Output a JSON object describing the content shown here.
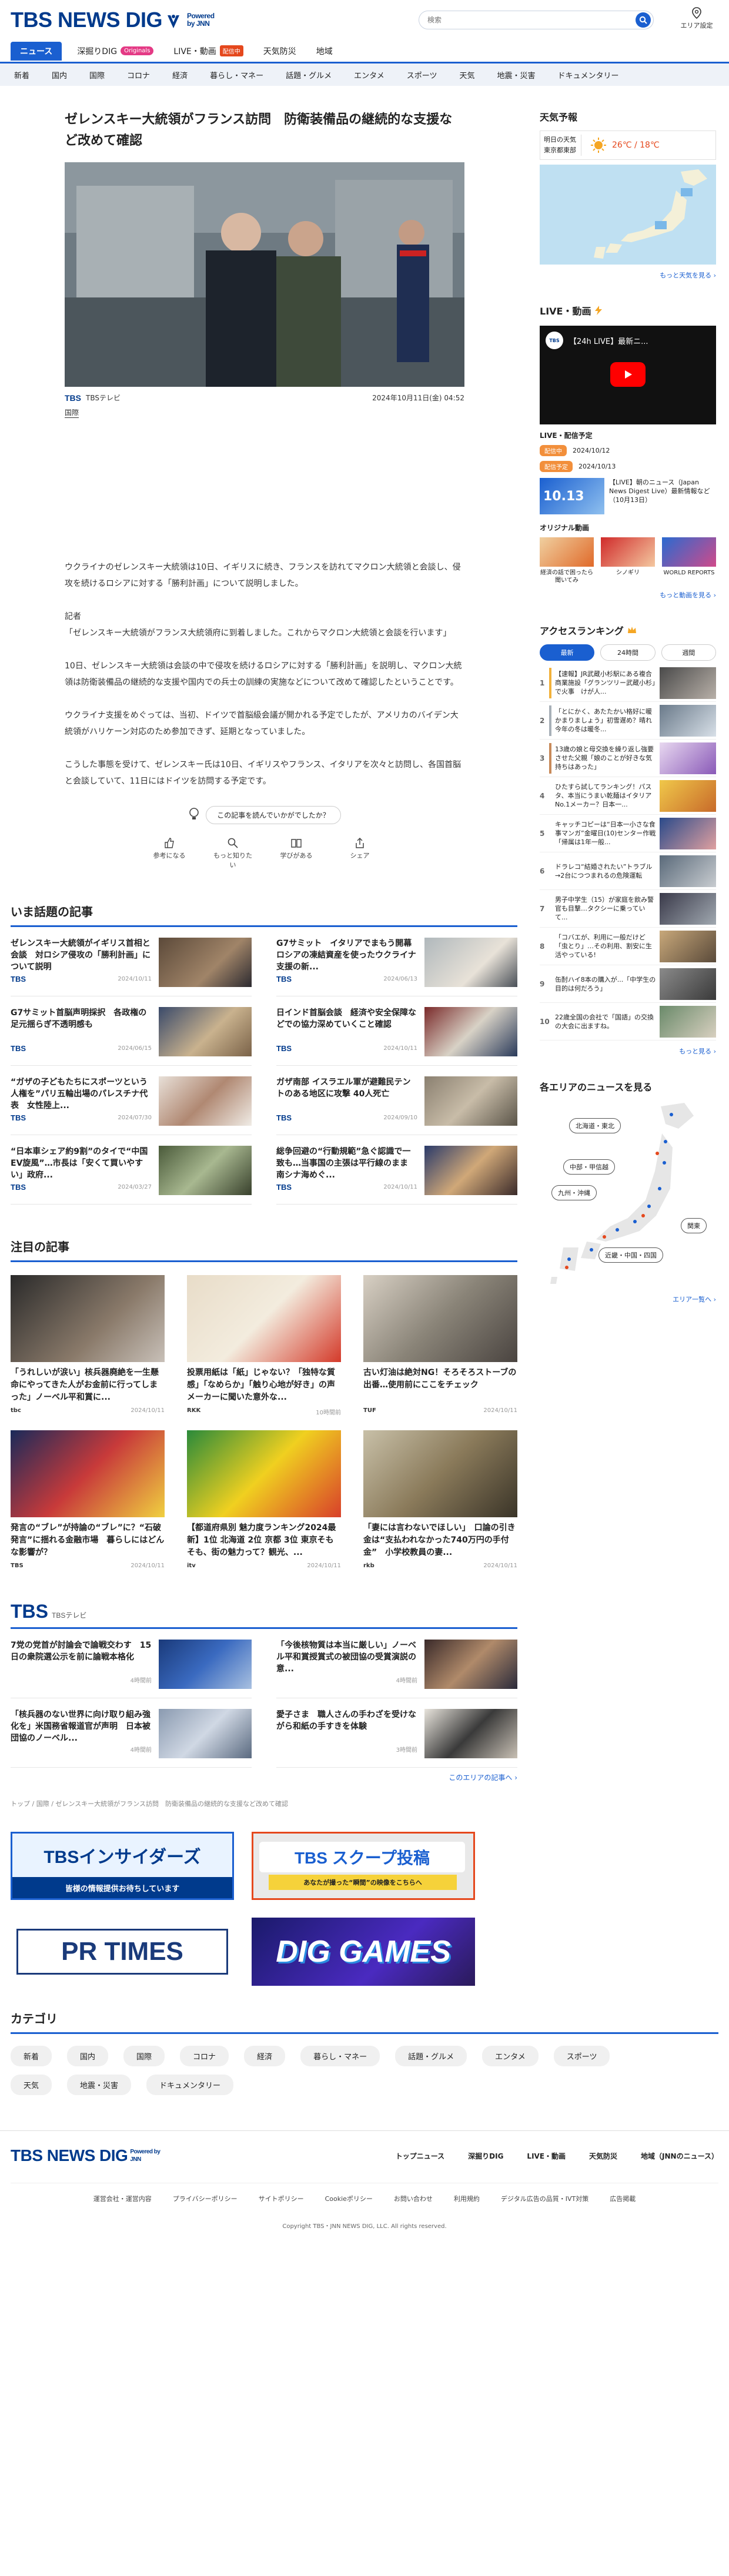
{
  "header": {
    "logo_text": "TBS NEWS DIG",
    "powered": "Powered by JNN",
    "search_placeholder": "検索",
    "area_setting": "エリア設定"
  },
  "nav": {
    "items": [
      "ニュース",
      "深掘りDIG",
      "LIVE・動画",
      "天気防災",
      "地域"
    ],
    "originals_badge": "Originals",
    "live_badge": "配信中"
  },
  "subnav": [
    "新着",
    "国内",
    "国際",
    "コロナ",
    "経済",
    "暮らし・マネー",
    "話題・グルメ",
    "エンタメ",
    "スポーツ",
    "天気",
    "地震・災害",
    "ドキュメンタリー"
  ],
  "article": {
    "title": "ゼレンスキー大統領がフランス訪問　防衛装備品の継続的な支援など改めて確認",
    "source": "TBSテレビ",
    "date": "2024年10月11日(金) 04:52",
    "tag": "国際",
    "paragraphs": [
      "ウクライナのゼレンスキー大統領は10日、イギリスに続き、フランスを訪れてマクロン大統領と会談し、侵攻を続けるロシアに対する「勝利計画」について説明しました。",
      "記者\n「ゼレンスキー大統領がフランス大統領府に到着しました。これからマクロン大統領と会談を行います」",
      "10日、ゼレンスキー大統領は会談の中で侵攻を続けるロシアに対する「勝利計画」を説明し、マクロン大統領は防衛装備品の継続的な支援や国内での兵士の訓練の実施などについて改めて確認したということです。",
      "ウクライナ支援をめぐっては、当初、ドイツで首脳級会議が開かれる予定でしたが、アメリカのバイデン大統領がハリケーン対応のため参加できず、延期となっていました。",
      "こうした事態を受けて、ゼレンスキー氏は10日、イギリスやフランス、イタリアを次々と訪問し、各国首脳と会談していて、11日にはドイツを訪問する予定です。"
    ],
    "feedback_question": "この記事を読んでいかがでしたか？",
    "feedback": [
      "参考になる",
      "もっと知りたい",
      "学びがある",
      "シェア"
    ]
  },
  "trending": {
    "title": "いま話題の記事",
    "items": [
      {
        "title": "ゼレンスキー大統領がイギリス首相と会談　対ロシア侵攻の「勝利計画」について説明",
        "src": "TBS",
        "date": "2024/10/11"
      },
      {
        "title": "G7サミット　イタリアでまもう開幕　ロシアの凍結資産を使ったウクライナ支援の新...",
        "src": "TBS",
        "date": "2024/06/13"
      },
      {
        "title": "G7サミット首脳声明採択　各政権の足元揺らぎ不透明感も",
        "src": "TBS",
        "date": "2024/06/15"
      },
      {
        "title": "日インド首脳会談　経済や安全保障などでの協力深めていくこと確認",
        "src": "TBS",
        "date": "2024/10/11"
      },
      {
        "title": "“ガザの子どもたちにスポーツという人権を”パリ五輪出場のパレスチナ代表　女性陸上...",
        "src": "TBS",
        "date": "2024/07/30"
      },
      {
        "title": "ガザ南部 イスラエル軍が避難民テントのある地区に攻撃 40人死亡",
        "src": "TBS",
        "date": "2024/09/10"
      },
      {
        "title": "“日本車シェア約9割”のタイで“中国EV旋風”…市長は「安くて買いやすい」政府...",
        "src": "TBS",
        "date": "2024/03/27"
      },
      {
        "title": "総争回避の“行動規範”急ぐ認識で一致も…当事国の主張は平行線のまま 南シナ海めぐ...",
        "src": "TBS",
        "date": "2024/10/11"
      }
    ]
  },
  "featured": {
    "title": "注目の記事",
    "items": [
      {
        "title": "「うれしいが涙い」核兵器廃絶を一生懸命にやってきた人がお金前に行ってしまった」ノーベル平和賞に...",
        "src": "tbc",
        "date": "2024/10/11"
      },
      {
        "title": "投票用紙は「紙」じゃない？「独特な質感」「なめらか」「触り心地が好き」の声 メーカーに聞いた意外な...",
        "src": "RKK",
        "date": "10時間前"
      },
      {
        "title": "古い灯油は絶対NG！そろそろストーブの出番…使用前にここをチェック",
        "src": "TUF",
        "date": "2024/10/11"
      },
      {
        "title": "発言の“ブレ”が持論の“ブレ”に？“石破発言”に揺れる金融市場　暮らしにはどんな影響が？",
        "src": "TBS",
        "date": "2024/10/11"
      },
      {
        "title": "【都道府県別 魅力度ランキング2024最新】1位 北海道 2位 京都 3位 東京そもそも、街の魅力って？観光、...",
        "src": "itv",
        "date": "2024/10/11"
      },
      {
        "title": "「妻には言わないでほしい」　口論の引き金は“支払われなかった740万円の手付金”　小学校教員の妻...",
        "src": "rkb",
        "date": "2024/10/11"
      }
    ]
  },
  "tbs_section": {
    "logo": "TBS",
    "label": "TBSテレビ",
    "items": [
      {
        "title": "7党の党首が討論会で論戦交わす　15日の衆院選公示を前に論戦本格化",
        "date": "4時間前"
      },
      {
        "title": "「今後核物質は本当に厳しい」ノーベル平和賞授賞式の被団協の受賞演説の意...",
        "date": "4時間前"
      },
      {
        "title": "「核兵器のない世界に向け取り組み強化を」米国務省報道官が声明　日本被団協のノーベル...",
        "date": "4時間前"
      },
      {
        "title": "愛子さま　職人さんの手わざを受けながら和紙の手すきを体験",
        "date": "3時間前"
      }
    ],
    "more": "このエリアの記事へ ›"
  },
  "breadcrumb": "トップ / 国際 / ゼレンスキー大統領がフランス訪問　防衛装備品の継続的な支援など改めて確認",
  "banners": {
    "insiders": "TBSインサイダーズ",
    "insiders_sub": "皆様の情報提供お待ちしています",
    "scoop": "TBS スクープ投稿",
    "scoop_sub": "あなたが撮った“瞬間”の映像をこちらへ",
    "prtimes": "PR TIMES",
    "dig_games": "DIG GAMES"
  },
  "categories": {
    "title": "カテゴリ",
    "items": [
      "新着",
      "国内",
      "国際",
      "コロナ",
      "経済",
      "暮らし・マネー",
      "話題・グルメ",
      "エンタメ",
      "スポーツ",
      "天気",
      "地震・災害",
      "ドキュメンタリー"
    ]
  },
  "footer": {
    "links": [
      "トップニュース",
      "深掘りDIG",
      "LIVE・動画",
      "天気防災",
      "地域（JNNのニュース）"
    ],
    "sub": [
      "運営会社・運営内容",
      "プライバシーポリシー",
      "サイトポリシー",
      "Cookieポリシー",
      "お問い合わせ",
      "利用規約",
      "デジタル広告の品質・IVT対策",
      "広告掲載"
    ],
    "copyright": "Copyright TBS・JNN NEWS DIG, LLC. All rights reserved."
  },
  "sidebar": {
    "weather_title": "天気予報",
    "weather_loc1": "明日の天気",
    "weather_loc2": "東京都東部",
    "weather_temp": "26℃ / 18℃",
    "weather_more": "もっと天気を見る ›",
    "live_title": "LIVE・動画",
    "live_video_title": "【24h LIVE】最新ニ...",
    "live_sched_title": "LIVE・配信予定",
    "sched": [
      {
        "pill": "配信中",
        "date": "2024/10/12"
      },
      {
        "pill": "配信予定",
        "date": "2024/10/13"
      }
    ],
    "live_item_title": "【LIVE】朝のニュース（Japan News Digest Live）最新情報など（10月13日）",
    "live_item_time": "10.13",
    "orig_title": "オリジナル動画",
    "orig": [
      "経済の話で困ったら聞いてみ",
      "シノギリ",
      "WORLD REPORTS"
    ],
    "orig_more": "もっと動画を見る ›",
    "rank_title": "アクセスランキング",
    "rank_tabs": [
      "最新",
      "24時間",
      "週間"
    ],
    "ranks": [
      "【速報】JR武蔵小杉駅にある複合商業施設「グランツリー武蔵小杉」で火事　けが人...",
      "「とにかく、あたたかい格好に暖かまりましょう」初雪遅め？晴れ今年の冬は暖冬...",
      "13歳の娘と母交換を繰り返し強要させた父親「娘のことが好きな気持ちはあった」",
      "ひたすら試してランキング！パスタ、本当にうまい乾麺はイタリアNo.1メーカー？日本一...",
      "キャッチコピーは“日本一小さな食事マンガ”金曜日(10)センター作戦「帰属は1年一般...",
      "ドラレコ“結婚されたい”トラブル→2台につつまれるの危険運転",
      "男子中学生（15）が家庭を飲み警官も目撃…タクシーに乗っていて...",
      "「コバエが、利用に一般だけど「虫とり」…その利用、割安に生活やっている!",
      "缶酎ハイ8本の購入が...「中学生の目的は何だろう」",
      "22歳全国の会社で「国語」の交換の大会に出ますね。"
    ],
    "rank_more": "もっと見る ›",
    "area_title": "各エリアのニュースを見る",
    "regions": [
      "北海道・東北",
      "中部・甲信越",
      "九州・沖縄",
      "関東",
      "近畿・中国・四国"
    ],
    "area_more": "エリア一覧へ ›"
  }
}
